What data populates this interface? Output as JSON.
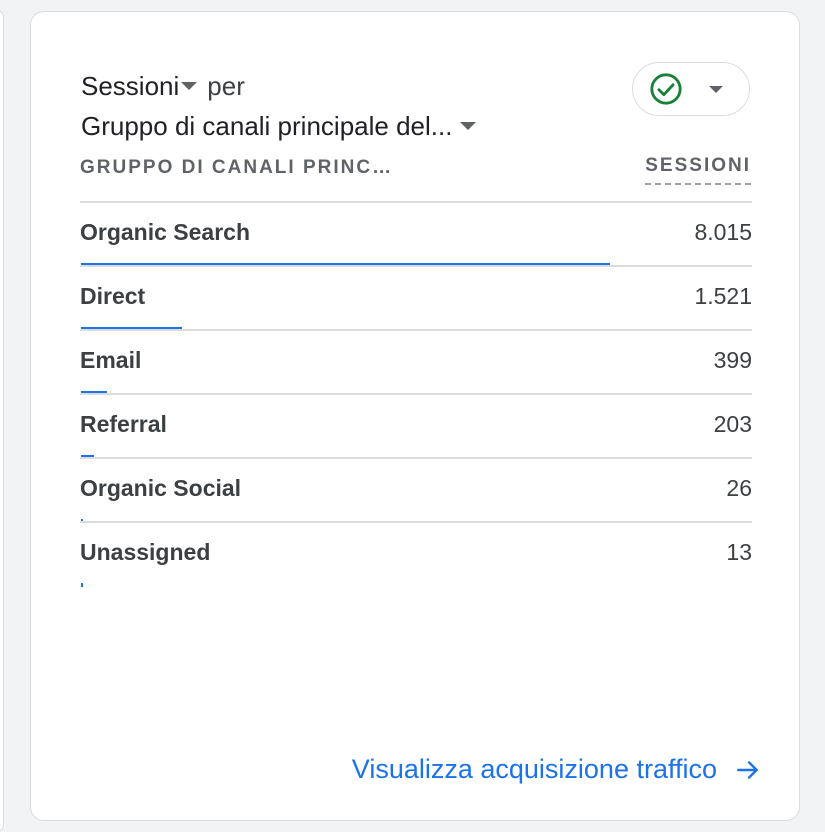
{
  "card": {
    "metric_label": "Sessioni",
    "per_label": "per",
    "dimension_label": "Gruppo di canali principale del...",
    "column_dimension": "GRUPPO DI CANALI PRINC…",
    "column_metric": "SESSIONI",
    "status_icon": "check-circle-icon",
    "accent_color": "#1a73e8",
    "status_color": "#188038",
    "rows": [
      {
        "label": "Organic Search",
        "value": "8.015",
        "share": 1.0
      },
      {
        "label": "Direct",
        "value": "1.521",
        "share": 0.19
      },
      {
        "label": "Email",
        "value": "399",
        "share": 0.05
      },
      {
        "label": "Referral",
        "value": "203",
        "share": 0.025
      },
      {
        "label": "Organic Social",
        "value": "26",
        "share": 0.003
      },
      {
        "label": "Unassigned",
        "value": "13",
        "share": 0.0016
      }
    ],
    "footer_link": "Visualizza acquisizione traffico"
  }
}
